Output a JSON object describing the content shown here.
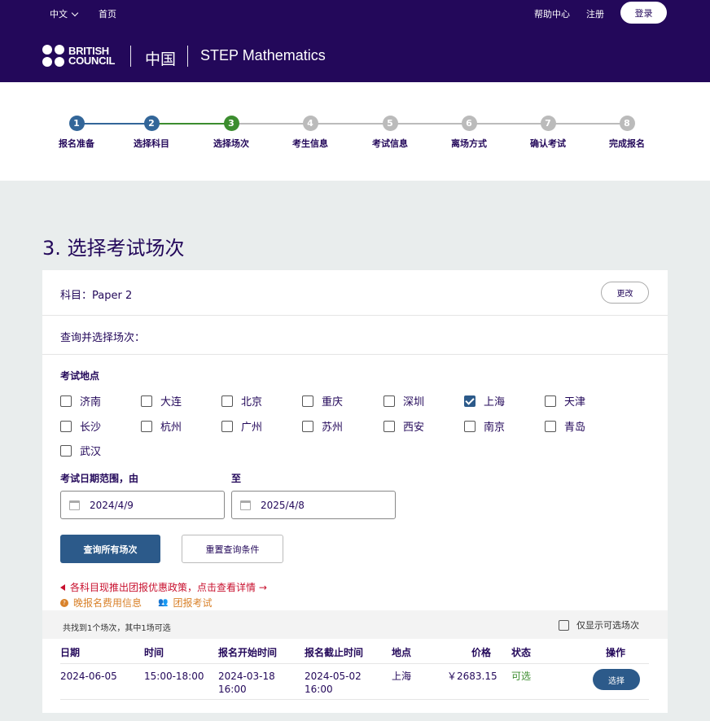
{
  "header": {
    "language": "中文",
    "home": "首页",
    "help": "帮助中心",
    "register": "注册",
    "login": "登录",
    "logo_line1": "BRITISH",
    "logo_line2": "COUNCIL",
    "region": "中国",
    "product": "STEP Mathematics",
    "logo_icon": "british-council-dots-logo"
  },
  "stepper": {
    "colors": {
      "done": "#336699",
      "current": "#3c8d2f",
      "todo": "#bbbbbb"
    },
    "current_step": 3,
    "steps": [
      {
        "num": "1",
        "label": "报名准备"
      },
      {
        "num": "2",
        "label": "选择科目"
      },
      {
        "num": "3",
        "label": "选择场次"
      },
      {
        "num": "4",
        "label": "考生信息"
      },
      {
        "num": "5",
        "label": "考试信息"
      },
      {
        "num": "6",
        "label": "离场方式"
      },
      {
        "num": "7",
        "label": "确认考试"
      },
      {
        "num": "8",
        "label": "完成报名"
      }
    ]
  },
  "page": {
    "title": "3. 选择考试场次"
  },
  "card": {
    "subject": "科目：Paper 2",
    "change": "更改",
    "query_label": "查询并选择场次：",
    "location_title": "考试地点",
    "cities": [
      {
        "name": "济南",
        "checked": false
      },
      {
        "name": "大连",
        "checked": false
      },
      {
        "name": "北京",
        "checked": false
      },
      {
        "name": "重庆",
        "checked": false
      },
      {
        "name": "深圳",
        "checked": false
      },
      {
        "name": "上海",
        "checked": true
      },
      {
        "name": "天津",
        "checked": false
      },
      {
        "name": "长沙",
        "checked": false
      },
      {
        "name": "杭州",
        "checked": false
      },
      {
        "name": "广州",
        "checked": false
      },
      {
        "name": "苏州",
        "checked": false
      },
      {
        "name": "西安",
        "checked": false
      },
      {
        "name": "南京",
        "checked": false
      },
      {
        "name": "青岛",
        "checked": false
      },
      {
        "name": "武汉",
        "checked": false
      }
    ],
    "date_from_label": "考试日期范围，由",
    "date_to_label": "至",
    "date_from": "2024/4/9",
    "date_to": "2025/4/8",
    "search_btn": "查询所有场次",
    "reset_btn": "重置查询条件",
    "promo": "各科目现推出团报优惠政策，点击查看详情 →",
    "late_fee": "晚报名费用信息",
    "group": "团报考试",
    "result_summary": "共找到1个场次，其中1场可选",
    "only_available": "仅显示可选场次",
    "table": {
      "headers": [
        "日期",
        "时间",
        "报名开始时间",
        "报名截止时间",
        "地点",
        "价格",
        "状态",
        "操作"
      ],
      "rows": [
        {
          "date": "2024-06-05",
          "time": "15:00-18:00",
          "reg_start": "2024-03-18",
          "reg_start_time": "16:00",
          "reg_end": "2024-05-02",
          "reg_end_time": "16:00",
          "location": "上海",
          "price": "￥2683.15",
          "status": "可选",
          "action": "选择"
        }
      ]
    }
  }
}
